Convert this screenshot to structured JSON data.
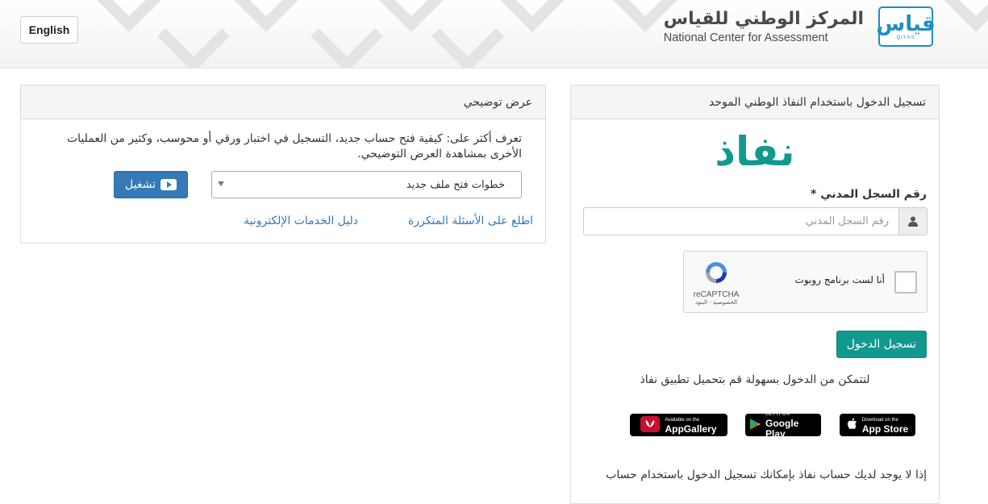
{
  "header": {
    "lang_button": "English",
    "brand_ar": "المركز الوطني للقياس",
    "brand_en": "National Center for Assessment",
    "logo_ar": "قياس",
    "logo_en": "QIYAS"
  },
  "login": {
    "title": "تسجيل الدخول باستخدام النفاذ الوطني الموحد",
    "nafath_logo": "نفاذ",
    "id_label": "رقم السجل المدني *",
    "id_placeholder": "رقم السجل المدني",
    "id_value": "",
    "captcha_label": "أنا لست برنامج روبوت",
    "captcha_brand": "reCAPTCHA",
    "captcha_links": "الخصوصية - البنود",
    "submit_label": "تسجيل الدخول",
    "app_hint": "لتتمكن من الدخول بسهولة قم بتحميل تطبيق نفاذ",
    "stores": {
      "apple_small": "Download on the",
      "apple_big": "App Store",
      "google_small": "GET IT ON",
      "google_big": "Google Play",
      "huawei_small": "Available on the",
      "huawei_big": "AppGallery"
    },
    "bottom_note": "إذا لا يوجد لديك حساب نفاذ بإمكانك تسجيل الدخول باستخدام حساب"
  },
  "demo": {
    "title": "عرض توضيحي",
    "description": "تعرف أكثر على: كيفية فتح حساب جديد، التسجيل في اختبار ورقي أو محوسب، وكثير من العمليات الأخرى بمشاهدة العرض التوضيحي.",
    "select_value": "خطوات فتح ملف جديد",
    "play_label": "تشغيل",
    "link_faq": "اطلع على الأسئلة المتكررة",
    "link_guide": "دليل الخدمات الإلكترونية"
  },
  "colors": {
    "primary_green": "#11998e",
    "link_blue": "#337ab7",
    "qiyas_blue": "#1d8fc4"
  }
}
